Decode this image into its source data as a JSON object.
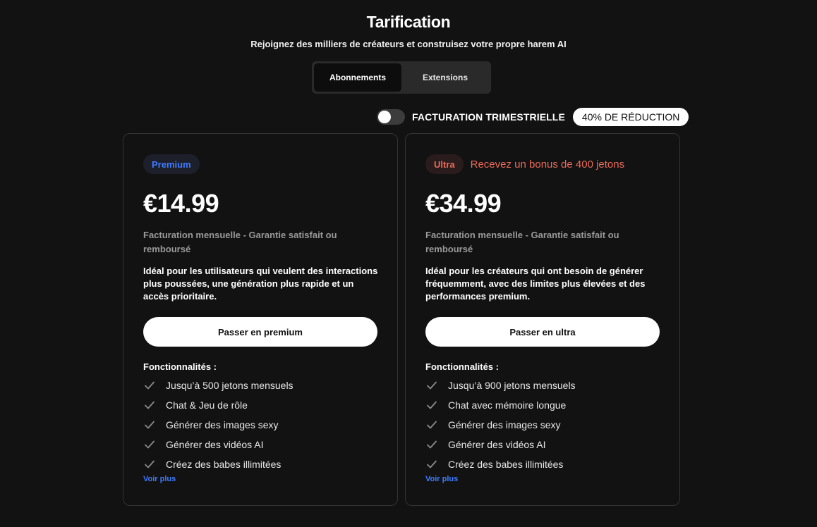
{
  "header": {
    "title": "Tarification",
    "subtitle": "Rejoignez des milliers de créateurs et construisez votre propre harem AI"
  },
  "tabs": [
    {
      "label": "Abonnements",
      "active": true
    },
    {
      "label": "Extensions",
      "active": false
    }
  ],
  "billing": {
    "toggle_on": false,
    "label": "FACTURATION TRIMESTRIELLE",
    "discount": "40% DE RÉDUCTION"
  },
  "plans": [
    {
      "badge": "Premium",
      "bonus": "",
      "price": "€14.99",
      "billing_note": "Facturation mensuelle - Garantie satisfait ou remboursé",
      "description": "Idéal pour les utilisateurs qui veulent des interactions plus poussées, une génération plus rapide et un accès prioritaire.",
      "cta": "Passer en premium",
      "features_title": "Fonctionnalités :",
      "features": [
        "Jusqu’à 500 jetons mensuels",
        "Chat & Jeu de rôle",
        "Générer des images sexy",
        "Générer des vidéos AI",
        "Créez des babes illimitées"
      ],
      "see_more": "Voir plus"
    },
    {
      "badge": "Ultra",
      "bonus": "Recevez un bonus de 400 jetons",
      "price": "€34.99",
      "billing_note": "Facturation mensuelle - Garantie satisfait ou remboursé",
      "description": "Idéal pour les créateurs qui ont besoin de générer fréquemment, avec des limites plus élevées et des performances premium.",
      "cta": "Passer en ultra",
      "features_title": "Fonctionnalités :",
      "features": [
        "Jusqu’à 900 jetons mensuels",
        "Chat avec mémoire longue",
        "Générer des images sexy",
        "Générer des vidéos AI",
        "Créez des babes illimitées"
      ],
      "see_more": "Voir plus"
    }
  ],
  "colors": {
    "background": "#121212",
    "premium_accent": "#3d7bff",
    "ultra_accent": "#ea6a5a",
    "check_icon": "#8a8a8a"
  },
  "icons": {
    "feature_check": "check-icon"
  }
}
